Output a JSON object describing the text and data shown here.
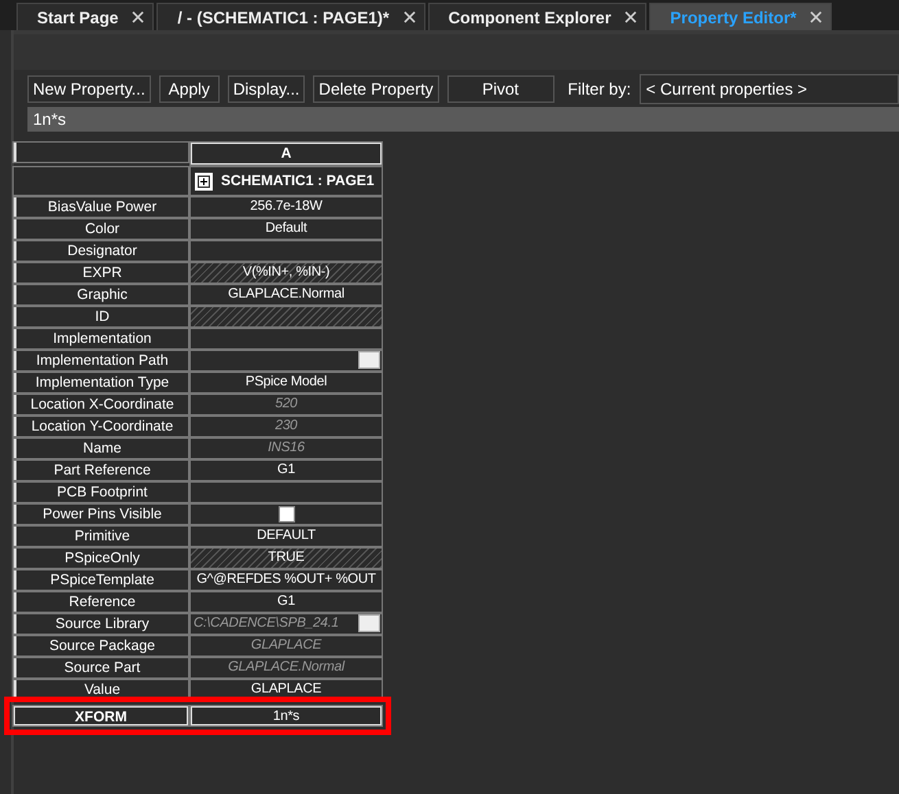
{
  "tabs": [
    {
      "label": "Start Page",
      "selected": false
    },
    {
      "label": "/ - (SCHEMATIC1 : PAGE1)*",
      "selected": false
    },
    {
      "label": "Component Explorer",
      "selected": false
    },
    {
      "label": "Property Editor*",
      "selected": true
    }
  ],
  "toolbar": {
    "buttons": [
      "New Property...",
      "Apply",
      "Display...",
      "Delete Property",
      "Pivot"
    ],
    "filter_label": "Filter by:",
    "filter_value": "< Current properties >"
  },
  "edit_field": {
    "value": "1n*s"
  },
  "table": {
    "column": "A",
    "group": "SCHEMATIC1 : PAGE1",
    "rows": [
      {
        "label": "BiasValue Power",
        "value": "256.7e-18W",
        "kind": "text",
        "hatched": false,
        "readonly": false,
        "browse": false,
        "highlighted": false
      },
      {
        "label": "Color",
        "value": "Default",
        "kind": "text",
        "hatched": false,
        "readonly": false,
        "browse": false,
        "highlighted": false
      },
      {
        "label": "Designator",
        "kind": "text",
        "hatched": false,
        "browse": false,
        "highlighted": false
      },
      {
        "label": "EXPR",
        "value": "V(%IN+, %IN-)",
        "kind": "text",
        "hatched": true,
        "readonly": false,
        "browse": false,
        "highlighted": false
      },
      {
        "label": "Graphic",
        "value": "GLAPLACE.Normal",
        "kind": "text",
        "hatched": false,
        "readonly": false,
        "browse": false,
        "highlighted": false
      },
      {
        "label": "ID",
        "kind": "text",
        "hatched": true,
        "browse": false,
        "highlighted": false
      },
      {
        "label": "Implementation",
        "kind": "text",
        "hatched": false,
        "browse": false,
        "highlighted": false
      },
      {
        "label": "Implementation Path",
        "kind": "text",
        "hatched": false,
        "browse": true,
        "highlighted": false
      },
      {
        "label": "Implementation Type",
        "value": "PSpice Model",
        "kind": "text",
        "hatched": false,
        "readonly": false,
        "browse": false,
        "highlighted": false
      },
      {
        "label": "Location X-Coordinate",
        "value": "520",
        "kind": "text",
        "hatched": false,
        "readonly": true,
        "browse": false,
        "highlighted": false
      },
      {
        "label": "Location Y-Coordinate",
        "value": "230",
        "kind": "text",
        "hatched": false,
        "readonly": true,
        "browse": false,
        "highlighted": false
      },
      {
        "label": "Name",
        "value": "INS16",
        "kind": "text",
        "hatched": false,
        "readonly": true,
        "browse": false,
        "highlighted": false
      },
      {
        "label": "Part Reference",
        "value": "G1",
        "kind": "text",
        "hatched": false,
        "readonly": false,
        "browse": false,
        "highlighted": false
      },
      {
        "label": "PCB Footprint",
        "kind": "text",
        "hatched": false,
        "browse": false,
        "highlighted": false
      },
      {
        "label": "Power Pins Visible",
        "kind": "checkbox",
        "checked": false,
        "hatched": false,
        "browse": false,
        "highlighted": false
      },
      {
        "label": "Primitive",
        "value": "DEFAULT",
        "kind": "text",
        "hatched": false,
        "readonly": false,
        "browse": false,
        "highlighted": false
      },
      {
        "label": "PSpiceOnly",
        "value": "TRUE",
        "kind": "text",
        "hatched": true,
        "readonly": false,
        "browse": false,
        "highlighted": false
      },
      {
        "label": "PSpiceTemplate",
        "value": "G^@REFDES %OUT+ %OUT",
        "kind": "text",
        "hatched": false,
        "readonly": false,
        "browse": false,
        "highlighted": false
      },
      {
        "label": "Reference",
        "value": "G1",
        "kind": "text",
        "hatched": false,
        "readonly": false,
        "browse": false,
        "highlighted": false
      },
      {
        "label": "Source Library",
        "value": "C:\\CADENCE\\SPB_24.1",
        "kind": "text",
        "hatched": false,
        "readonly": true,
        "browse": true,
        "highlighted": false
      },
      {
        "label": "Source Package",
        "value": "GLAPLACE",
        "kind": "text",
        "hatched": false,
        "readonly": true,
        "browse": false,
        "highlighted": false
      },
      {
        "label": "Source Part",
        "value": "GLAPLACE.Normal",
        "kind": "text",
        "hatched": false,
        "readonly": true,
        "browse": false,
        "highlighted": false
      },
      {
        "label": "Value",
        "value": "GLAPLACE",
        "kind": "text",
        "hatched": false,
        "readonly": false,
        "browse": false,
        "highlighted": false
      },
      {
        "label": "XFORM",
        "value": "1n*s",
        "kind": "text",
        "hatched": false,
        "readonly": false,
        "browse": false,
        "highlighted": true
      }
    ]
  }
}
